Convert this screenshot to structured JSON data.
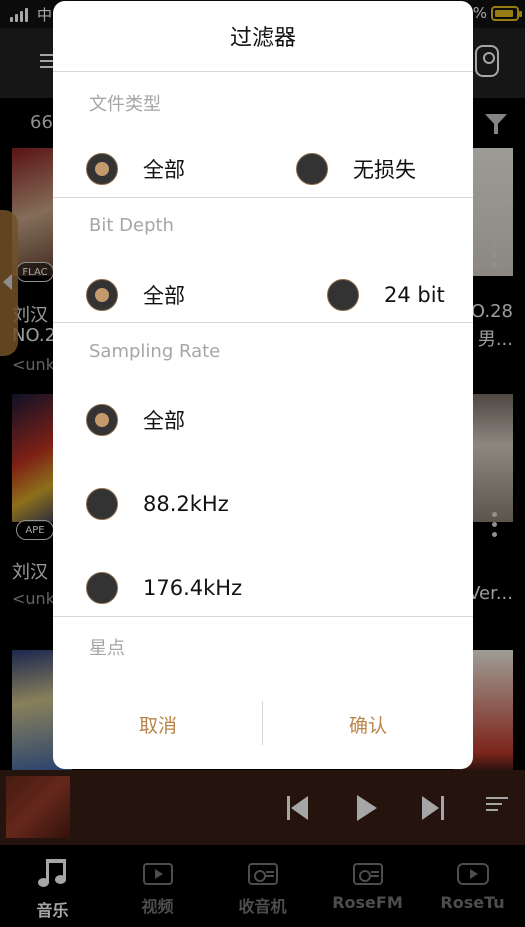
{
  "status_bar": {
    "carrier": "中",
    "battery_text": "%"
  },
  "background": {
    "album_count": "66",
    "albums": [
      {
        "format": "FLAC",
        "title": "刘汉",
        "subtitle": "NO.2",
        "artist": "<unk"
      },
      {
        "format": "APE",
        "title": "刘汉",
        "artist": "<unk"
      }
    ],
    "right_column": [
      {
        "title": "O.28",
        "subtitle": "男..."
      },
      {
        "title": "Ver..."
      }
    ]
  },
  "dialog": {
    "title": "过滤器",
    "sections": [
      {
        "header": "文件类型",
        "options": [
          {
            "label": "全部",
            "checked": true
          },
          {
            "label": "无损失",
            "checked": false
          }
        ]
      },
      {
        "header": "Bit Depth",
        "options": [
          {
            "label": "全部",
            "checked": true
          },
          {
            "label": "24 bit",
            "checked": false
          }
        ]
      },
      {
        "header": "Sampling Rate",
        "options": [
          {
            "label": "全部",
            "checked": true
          },
          {
            "label": "88.2kHz",
            "checked": false
          },
          {
            "label": "176.4kHz",
            "checked": false
          }
        ]
      },
      {
        "header": "星点",
        "options": []
      }
    ],
    "cancel_label": "取消",
    "confirm_label": "确认"
  },
  "tabs": [
    {
      "label": "音乐",
      "icon": "music-note-icon",
      "active": true
    },
    {
      "label": "视频",
      "icon": "video-icon",
      "active": false
    },
    {
      "label": "收音机",
      "icon": "radio-icon",
      "active": false
    },
    {
      "label": "RoseFM",
      "icon": "radio-icon",
      "active": false
    },
    {
      "label": "RoseTu",
      "icon": "youtube-icon",
      "active": false
    }
  ],
  "colors": {
    "accent": "#b98548",
    "radio_fill": "#333333",
    "radio_dot": "#c49a6c",
    "player_bar": "#3a1e14"
  }
}
